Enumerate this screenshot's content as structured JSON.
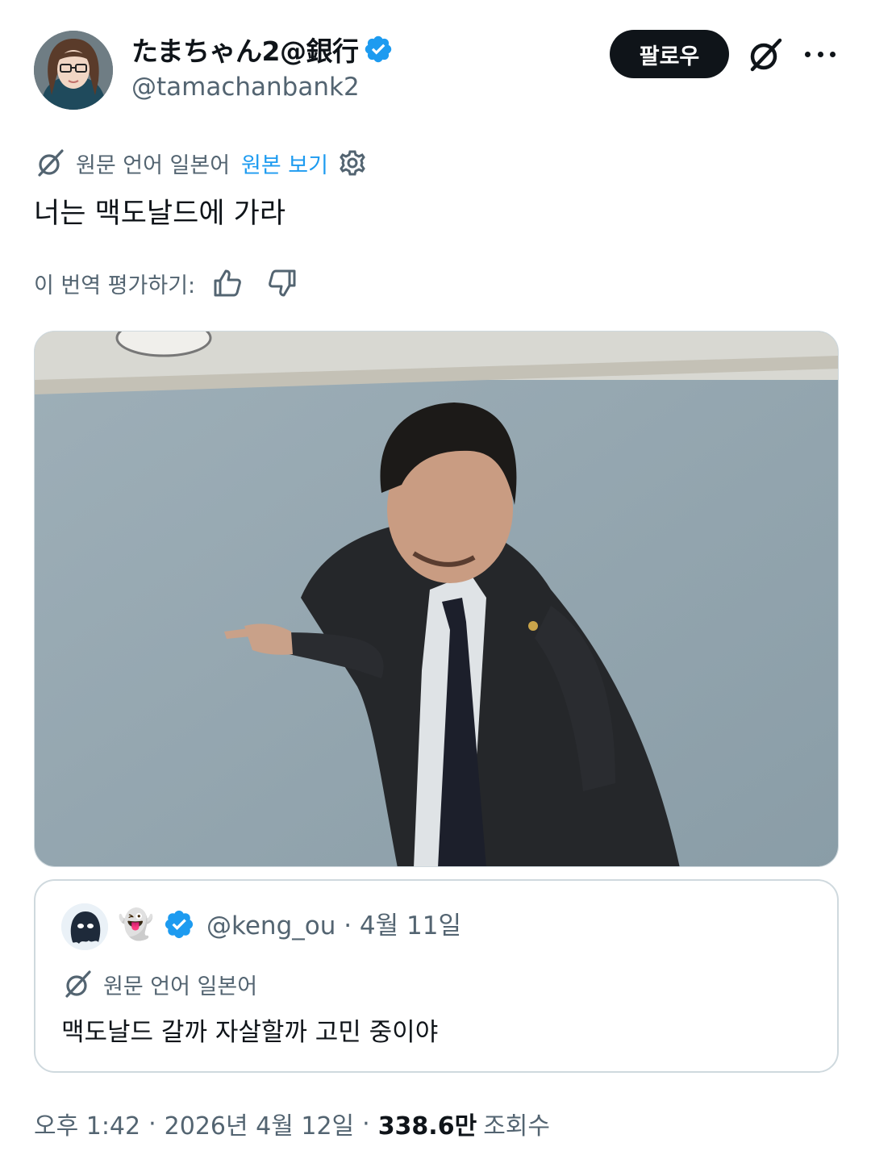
{
  "author": {
    "display_name": "たまちゃん2@銀行",
    "handle": "@tamachanbank2",
    "verified_color": "#1d9bf0"
  },
  "header": {
    "follow_label": "팔로우",
    "grok_icon": "grok-icon",
    "more_icon": "more-icon"
  },
  "translation": {
    "source_language_label": "원문 언어 일본어",
    "show_original_label": "원본 보기"
  },
  "tweet": {
    "text": "너는 맥도날드에 가라"
  },
  "rating": {
    "prompt": "이 번역 평가하기:"
  },
  "quoted_tweet": {
    "ghost_emoji": "👻",
    "meta": "@keng_ou · 4월 11일",
    "translation_label": "원문 언어 일본어",
    "text": "맥도날드 갈까 자살할까 고민 중이야"
  },
  "footer": {
    "time": "오후 1:42",
    "date": "2026년 4월 12일",
    "views_count": "338.6만",
    "views_label": "조회수",
    "separator": "·"
  }
}
